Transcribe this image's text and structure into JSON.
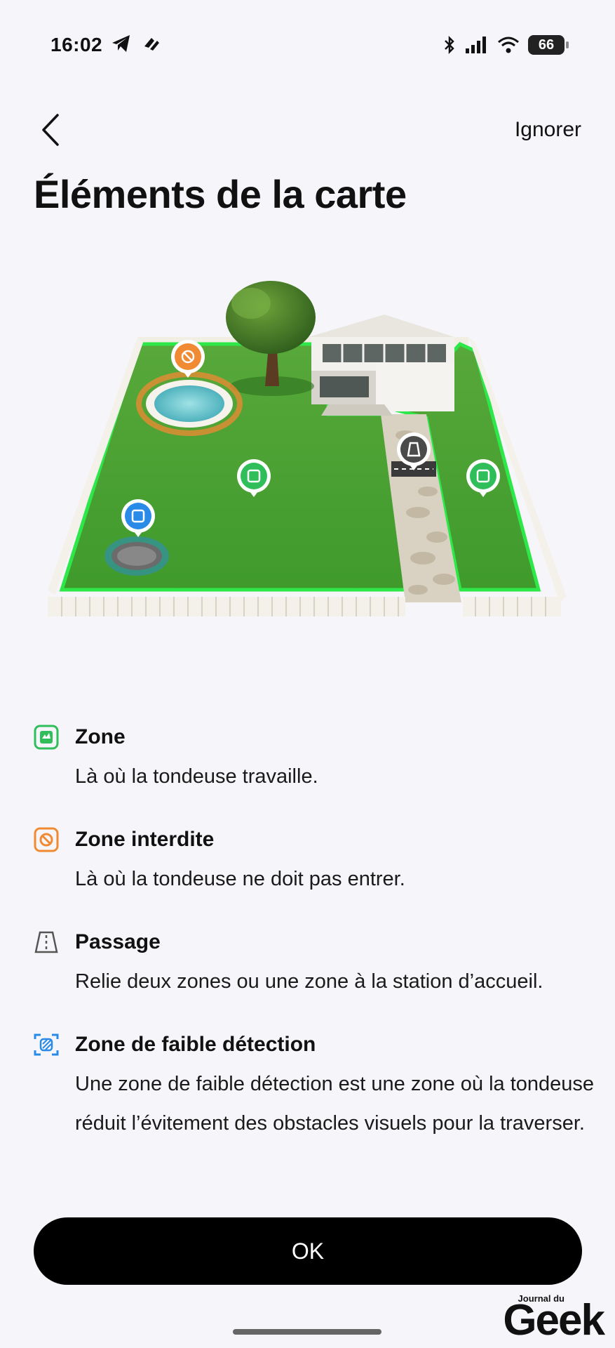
{
  "status_bar": {
    "time": "16:02",
    "battery": "66",
    "left_icons": [
      "telegram-icon",
      "app-notification-icon"
    ],
    "right_icons": [
      "bluetooth-icon",
      "signal-icon",
      "wifi-icon",
      "battery-icon"
    ]
  },
  "nav": {
    "skip_label": "Ignorer",
    "back_icon": "chevron-left-icon"
  },
  "page": {
    "title": "Éléments de la carte"
  },
  "legend": [
    {
      "icon": "zone-icon",
      "color": "#2fbe5a",
      "title": "Zone",
      "description": "Là où la tondeuse travaille."
    },
    {
      "icon": "no-go-zone-icon",
      "color": "#f08a33",
      "title": "Zone interdite",
      "description": "Là où la tondeuse ne doit pas entrer."
    },
    {
      "icon": "passage-icon",
      "color": "#555555",
      "title": "Passage",
      "description": "Relie deux zones ou une zone à la station d’accueil."
    },
    {
      "icon": "low-detection-zone-icon",
      "color": "#2a8ae8",
      "title": "Zone de faible détection",
      "description": "Une zone de faible détection est une zone où la tondeuse réduit l’évitement des obstacles visuels pour la traverser."
    }
  ],
  "actions": {
    "ok_label": "OK"
  },
  "watermark": {
    "small": "Journal du",
    "big": "Geek"
  },
  "colors": {
    "background": "#f6f6fa",
    "button": "#000000",
    "zone_green": "#2fbe5a",
    "no_go_orange": "#f08a33",
    "low_detection_blue": "#2a8ae8",
    "passage_gray": "#555555"
  }
}
